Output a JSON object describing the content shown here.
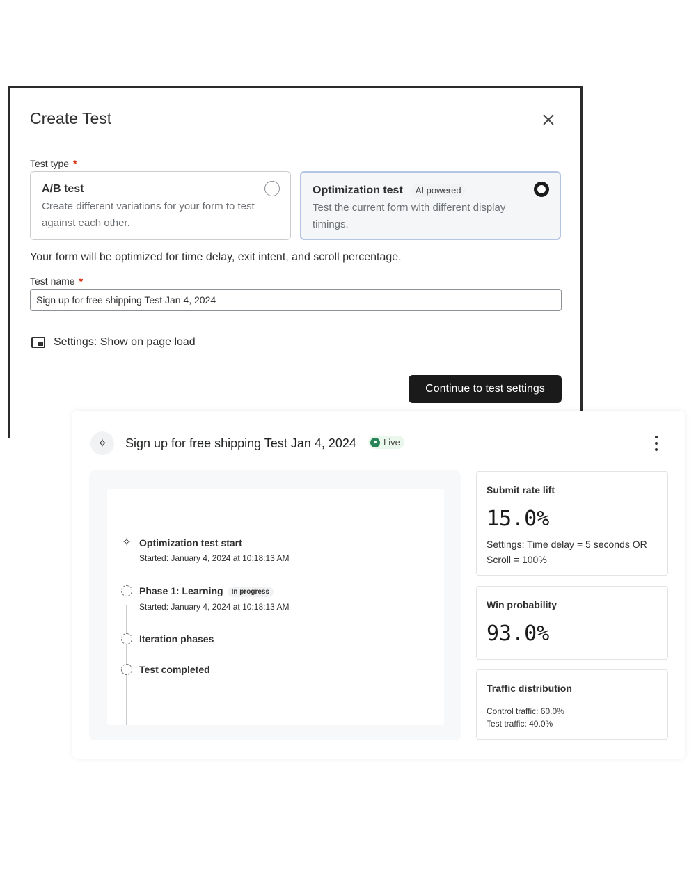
{
  "modal": {
    "title": "Create Test",
    "test_type_label": "Test type",
    "required_mark": "*",
    "options": [
      {
        "title": "A/B test",
        "description": "Create different variations for your form to test against each other.",
        "selected": false
      },
      {
        "title": "Optimization test",
        "badge": "AI powered",
        "description": "Test the current form with different display timings.",
        "selected": true
      }
    ],
    "optimize_note": "Your form will be optimized for time delay, exit intent, and scroll percentage.",
    "test_name_label": "Test name",
    "test_name_value": "Sign up for free shipping Test Jan 4, 2024",
    "settings_text": "Settings: Show on page load",
    "continue_button": "Continue to test settings"
  },
  "panel": {
    "title": "Sign up for free shipping Test Jan 4, 2024",
    "status_badge": "Live",
    "timeline": [
      {
        "title": "Optimization test start",
        "sub": "Started: January 4, 2024 at 10:18:13 AM",
        "icon": "sparkle-icon"
      },
      {
        "title": "Phase 1: Learning",
        "status": "In progress",
        "sub": "Started: January 4, 2024 at 10:18:13 AM",
        "icon": "dashed-circle-icon"
      },
      {
        "title": "Iteration phases",
        "icon": "dashed-circle-icon"
      },
      {
        "title": "Test completed",
        "icon": "dashed-circle-icon"
      }
    ],
    "metrics": {
      "submit_rate": {
        "label": "Submit rate lift",
        "value": "15.0%",
        "note": "Settings: Time delay = 5 seconds OR Scroll = 100%"
      },
      "win_probability": {
        "label": "Win probability",
        "value": "93.0%"
      },
      "traffic": {
        "label": "Traffic distribution",
        "control": "Control traffic: 60.0%",
        "test": "Test traffic: 40.0%"
      }
    }
  },
  "colors": {
    "primary_button": "#1a1a1a",
    "required": "#d72c0d",
    "live_green": "#29845a"
  }
}
